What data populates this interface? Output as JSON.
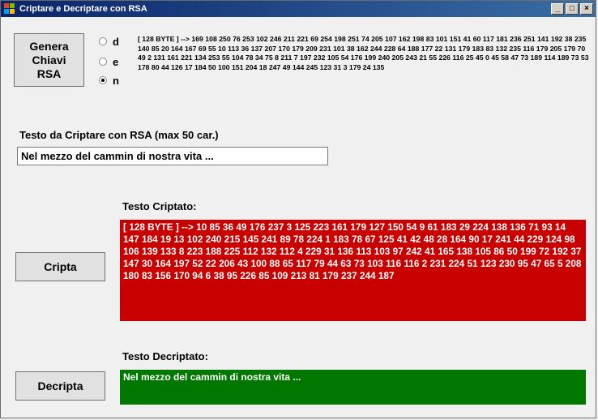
{
  "window": {
    "title": "Criptare e Decriptare con RSA",
    "controls": {
      "minimize": "_",
      "maximize": "□",
      "close": "×"
    }
  },
  "keygen": {
    "button_label": "Genera Chiavi RSA",
    "radios": [
      {
        "label": "d",
        "checked": false
      },
      {
        "label": "e",
        "checked": false
      },
      {
        "label": "n",
        "checked": true
      }
    ],
    "key_text": "[ 128 BYTE ] --> 169 108 250 76 253 102 246 211 221 69 254 198 251 74 205 107 162 198 83 101 151 41 60 117 181 236 251 141 192 38 235 140 85 20 164 167 69 55 10 113 36 137 207 170 179 209 231 101 38 162 244 228 64 188 177 22 131 179 183 83 132 235 116 179 205 179 70 49 2 131 161 221 134 253 55 104 78 34 75 8 211 7 197 232 105 54 176 199 240 205 243 21 55 226 116 25 45 0 45 58 47 73 189 114 189 73 53 178 80 44 126 17 184 50 100 151 204 18 247 49 144 245 123 31 3 179 24 135"
  },
  "input_section": {
    "label": "Testo da Criptare con RSA (max 50 car.)",
    "value": "Nel mezzo del cammin di nostra vita ..."
  },
  "encrypted": {
    "label": "Testo Criptato:",
    "button_label": "Cripta",
    "text": "[ 128 BYTE ] --> 10 85 36 49 176 237 3 125 223 161 179 127 150 54 9 61 183 29 224 138 136 71 93 14 147 184 19 13 102 240 215 145 241 89 78 224 1 183 78 67 125 41 42 48 28 164 90 17 241 44 229 124 98 106 139 133 8 223 188 225 112 132 112 4 229 31 136 113 103 97 242 41 165 138 105 86 50 199 72 192 37 147 30 164 197 52 22 206 43 100 88 65 117 79 44 63 73 103 116 116 2 231 224 51 123 230 95 47 65 5 208 180 83 156 170 94 6 38 95 226 85 109 213 81 179 237 244 187"
  },
  "decrypted": {
    "label": "Testo Decriptato:",
    "button_label": "Decripta",
    "text": "Nel mezzo del cammin di nostra vita ..."
  }
}
